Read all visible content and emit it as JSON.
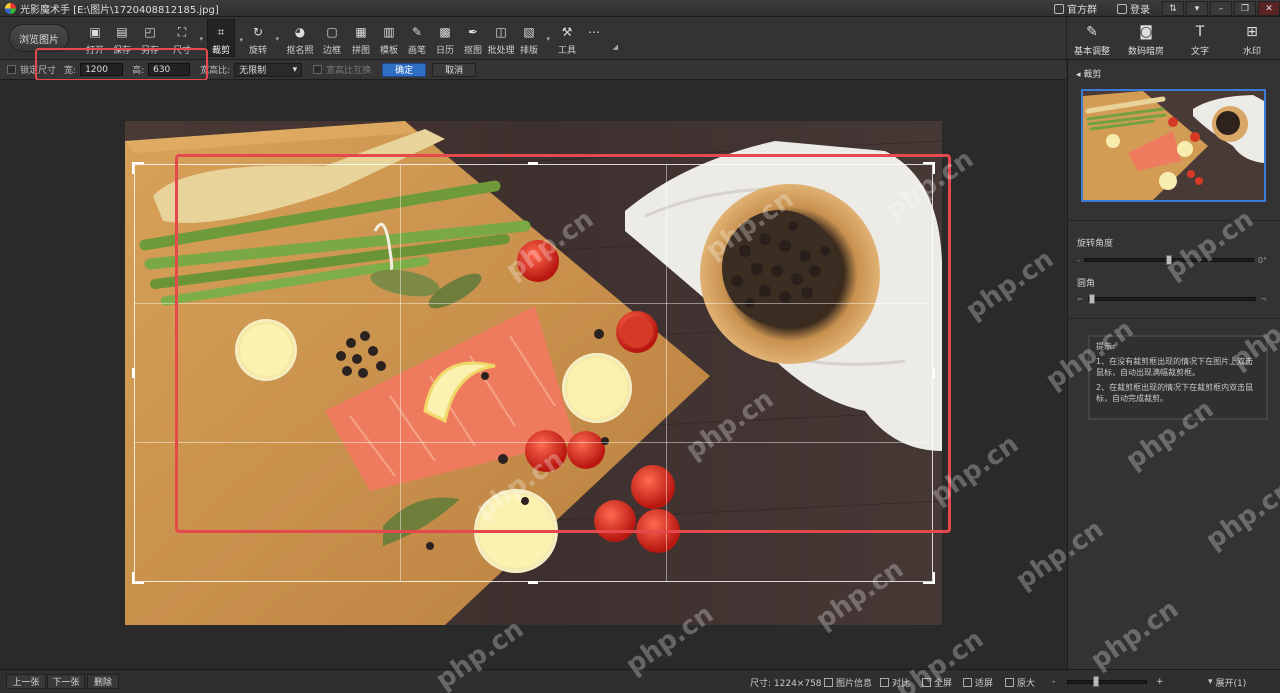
{
  "titlebar": {
    "app_title": "光影魔术手 [E:\\图片\\1720408812185.jpg]",
    "links": [
      {
        "label": "官方群",
        "icon": "group-icon"
      },
      {
        "label": "登录",
        "icon": "user-icon"
      }
    ],
    "window_buttons": [
      "menu",
      "minimize",
      "restore",
      "close"
    ]
  },
  "toolbar": {
    "browse_label": "浏览图片",
    "tools": [
      {
        "label": "打开",
        "icon": "open-icon"
      },
      {
        "label": "保存",
        "icon": "save-icon"
      },
      {
        "label": "另存",
        "icon": "save-as-icon"
      },
      {
        "label": "尺寸",
        "icon": "resize-icon"
      },
      {
        "label": "裁剪",
        "icon": "crop-icon"
      },
      {
        "label": "旋转",
        "icon": "rotate-icon"
      },
      {
        "label": "抠名照",
        "icon": "portrait-icon"
      },
      {
        "label": "边框",
        "icon": "border-icon"
      },
      {
        "label": "拼图",
        "icon": "collage-icon"
      },
      {
        "label": "模板",
        "icon": "template-icon"
      },
      {
        "label": "画笔",
        "icon": "brush-icon"
      },
      {
        "label": "日历",
        "icon": "calendar-icon"
      },
      {
        "label": "抠图",
        "icon": "cutout-icon"
      },
      {
        "label": "批处理",
        "icon": "batch-icon"
      },
      {
        "label": "排版",
        "icon": "layout-icon"
      },
      {
        "label": "工具",
        "icon": "tools-icon"
      },
      {
        "label": "",
        "icon": "more-icon"
      }
    ],
    "active_tool": "裁剪",
    "right_tools": [
      {
        "label": "基本调整",
        "icon": "adjust-icon"
      },
      {
        "label": "数码暗房",
        "icon": "darkroom-icon"
      },
      {
        "label": "文字",
        "icon": "text-icon"
      },
      {
        "label": "水印",
        "icon": "watermark-icon"
      }
    ]
  },
  "crop_options": {
    "lock_size_label": "锁定尺寸",
    "width_label": "宽:",
    "width_value": "1200",
    "height_label": "高:",
    "height_value": "630",
    "ratio_label": "宽高比:",
    "ratio_value": "无限制",
    "swap_label": "宽高比互换",
    "confirm_label": "确定",
    "cancel_label": "取消"
  },
  "right_panel": {
    "section_title": "裁剪",
    "rotation_label": "旋转角度",
    "rotation_min": "-",
    "rotation_value": "0°",
    "rotation_level": 0.5,
    "corner_label": "圆角",
    "corner_level": 0.0,
    "tips_title": "提示:",
    "tips": [
      "1、在没有裁剪框出现的情况下在图片上双击鼠标，自动出现满幅裁剪框。",
      "2、在裁剪框出现的情况下在裁剪框内双击鼠标，自动完成裁剪。"
    ]
  },
  "statusbar": {
    "prev_label": "上一张",
    "next_label": "下一张",
    "delete_label": "删除",
    "size_text": "尺寸: 1224×758",
    "info_label": "图片信息",
    "compare_label": "对比",
    "fullscreen_label": "全屏",
    "fit_label": "适屏",
    "original_label": "原大",
    "zoom_minus": "-",
    "zoom_plus": "+",
    "zoom_level": 0.35,
    "expand_label": "展开(1)"
  },
  "watermark_text": "php.cn",
  "colors": {
    "highlight": "#e5484d",
    "accent_blue": "#2f6fc4",
    "thumb_border": "#3d7bd6"
  }
}
